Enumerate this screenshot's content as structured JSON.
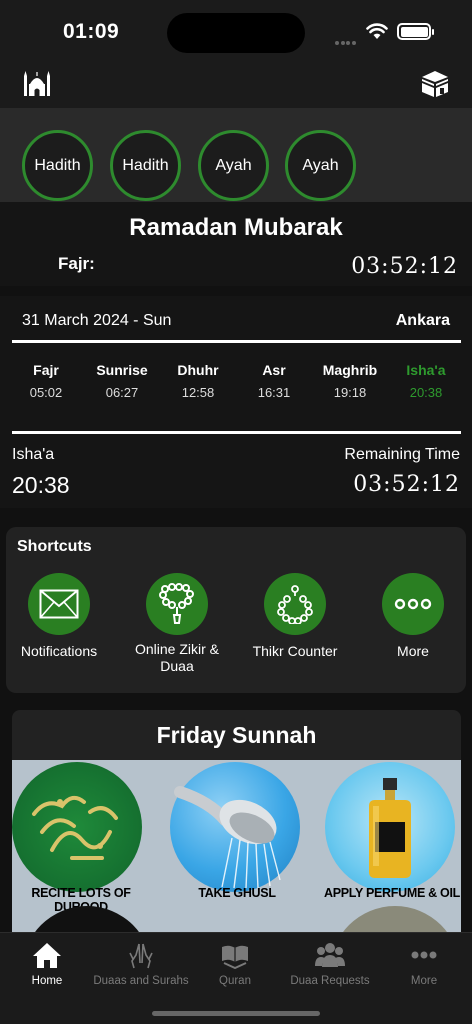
{
  "status": {
    "time": "01:09"
  },
  "top_nav": {
    "left_icon": "mosque-icon",
    "right_icon": "kaaba-icon"
  },
  "chips": [
    "Hadith",
    "Hadith",
    "Ayah",
    "Ayah"
  ],
  "greeting": {
    "title": "Ramadan Mubarak",
    "label": "Fajr:",
    "countdown": "03:52:12"
  },
  "prayer": {
    "date": "31 March 2024 - Sun",
    "city": "Ankara",
    "times": [
      {
        "name": "Fajr",
        "time": "05:02"
      },
      {
        "name": "Sunrise",
        "time": "06:27"
      },
      {
        "name": "Dhuhr",
        "time": "12:58"
      },
      {
        "name": "Asr",
        "time": "16:31"
      },
      {
        "name": "Maghrib",
        "time": "19:18"
      },
      {
        "name": "Isha'a",
        "time": "20:38"
      }
    ],
    "active_index": 5,
    "next_name": "Isha'a",
    "next_time": "20:38",
    "remaining_label": "Remaining Time",
    "remaining_value": "03:52:12"
  },
  "shortcuts": {
    "title": "Shortcuts",
    "items": [
      {
        "label": "Notifications",
        "icon": "envelope-icon"
      },
      {
        "label": "Online Zikir & Duaa",
        "icon": "prayer-beads-icon"
      },
      {
        "label": "Thikr Counter",
        "icon": "tasbih-icon"
      },
      {
        "label": "More",
        "icon": "more-dots-icon"
      }
    ]
  },
  "friday": {
    "title": "Friday Sunnah",
    "cards": [
      "RECITE LOTS OF DUROOD",
      "TAKE GHUSL",
      "APPLY PERFUME & OIL"
    ]
  },
  "tabs": [
    {
      "label": "Home",
      "icon": "home-icon"
    },
    {
      "label": "Duaas and Surahs",
      "icon": "praying-hands-icon"
    },
    {
      "label": "Quran",
      "icon": "quran-icon"
    },
    {
      "label": "Duaa Requests",
      "icon": "group-icon"
    },
    {
      "label": "More",
      "icon": "more-icon"
    }
  ],
  "colors": {
    "accent_green": "#2e8b2e",
    "shortcut_green": "#2a7f22",
    "background": "#111111"
  }
}
